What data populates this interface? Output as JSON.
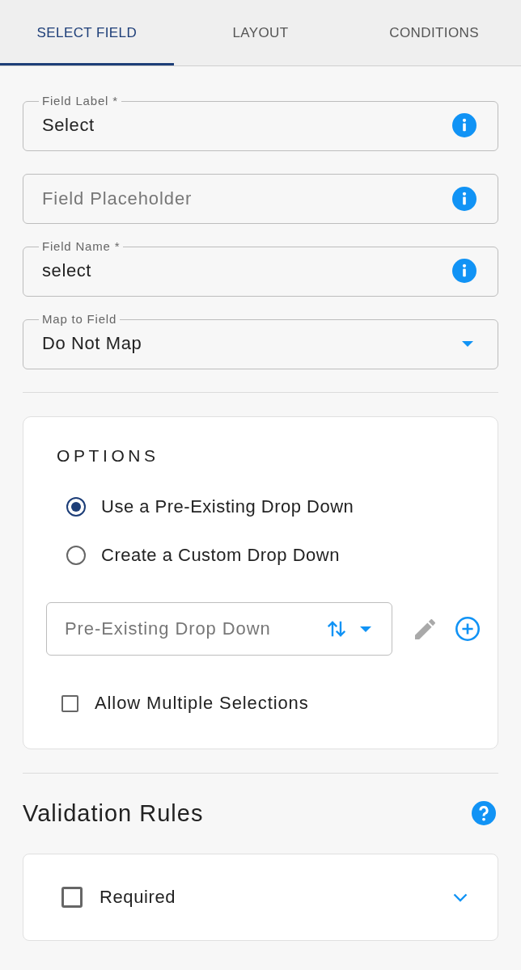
{
  "tabs": [
    {
      "label": "SELECT FIELD",
      "selected": true
    },
    {
      "label": "LAYOUT",
      "selected": false
    },
    {
      "label": "CONDITIONS",
      "selected": false
    }
  ],
  "fields": [
    {
      "kind": "text",
      "label": "Field Label *",
      "value": "Select"
    },
    {
      "kind": "text",
      "placeholder": "Field Placeholder"
    },
    {
      "kind": "text",
      "label": "Field Name *",
      "value": "select"
    },
    {
      "kind": "select",
      "label": "Map to Field",
      "value": "Do Not Map"
    }
  ],
  "options": {
    "title": "OPTIONS",
    "choices": [
      {
        "label": "Use a Pre-Existing Drop Down",
        "selected": true
      },
      {
        "label": "Create a Custom Drop Down",
        "selected": false
      }
    ],
    "dropdown": {
      "placeholder": "Pre-Existing Drop Down"
    },
    "actions": [
      {
        "kind": "edit",
        "disabled": true
      },
      {
        "kind": "add",
        "disabled": false
      }
    ],
    "multiple": {
      "label": "Allow Multiple Selections",
      "checked": false
    }
  },
  "validation": {
    "title": "Validation Rules",
    "rules": [
      {
        "label": "Required",
        "checked": false,
        "expanded": false
      }
    ]
  }
}
